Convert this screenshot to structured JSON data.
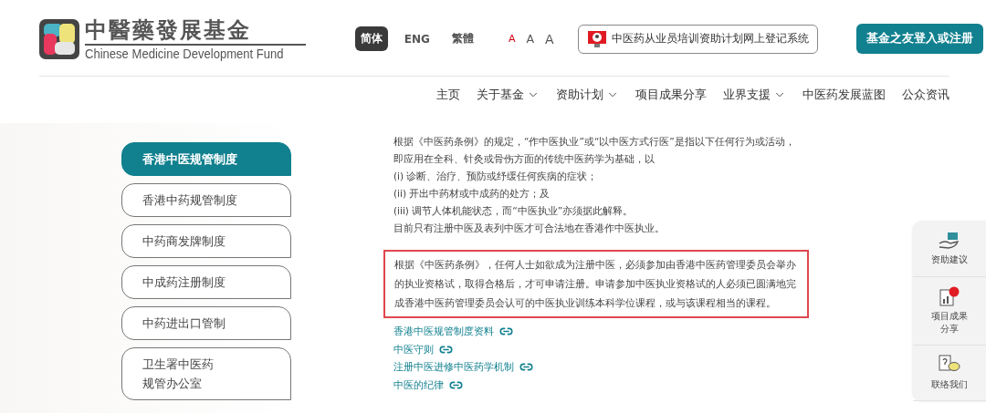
{
  "logo": {
    "title": "中醫藥發展基金",
    "subtitle": "Chinese Medicine Development Fund"
  },
  "languages": [
    {
      "label": "简体",
      "selected": true
    },
    {
      "label": "ENG",
      "selected": false
    },
    {
      "label": "繁體",
      "selected": false
    }
  ],
  "font_sizes": [
    {
      "label": "A",
      "selected": true
    },
    {
      "label": "A",
      "selected": false
    },
    {
      "label": "A",
      "selected": false
    }
  ],
  "system_button": "中医药从业员培训资助计划网上登记系统",
  "login_button": "基金之友登入或注册",
  "nav": [
    {
      "label": "主页",
      "has_menu": false
    },
    {
      "label": "关于基金",
      "has_menu": true
    },
    {
      "label": "资助计划",
      "has_menu": true
    },
    {
      "label": "项目成果分享",
      "has_menu": false
    },
    {
      "label": "业界支援",
      "has_menu": true
    },
    {
      "label": "中医药发展蓝图",
      "has_menu": false
    },
    {
      "label": "公众资讯",
      "has_menu": false
    }
  ],
  "sidebar": {
    "items": [
      {
        "label": "香港中医规管制度",
        "selected": true
      },
      {
        "label": "香港中药规管制度",
        "selected": false
      },
      {
        "label": "中药商发牌制度",
        "selected": false
      },
      {
        "label": "中成药注册制度",
        "selected": false
      },
      {
        "label": "中药进出口管制",
        "selected": false
      },
      {
        "lines": [
          "卫生署中医药",
          "规管办公室"
        ],
        "selected": false
      }
    ]
  },
  "content": {
    "lines": [
      "根据《中医药条例》的规定，“作中医执业”或“以中医方式行医”是指以下任何行为或活动，即应用在全科、针灸或骨伤方面的传统中医药学为基础，以",
      "(i) 诊断、治疗、预防或纾缓任何疾病的症状；",
      "(ii) 开出中药材或中成药的处方；及",
      "(iii) 调节人体机能状态，而“中医执业”亦须据此解释。",
      "目前只有注册中医及表列中医才可合法地在香港作中医执业。"
    ],
    "highlighted": "根据《中医药条例》，任何人士如欲成为注册中医，必须参加由香港中医药管理委员会举办的执业资格试，取得合格后，才可申请注册。申请参加中医执业资格试的人必须已圆满地完成香港中医药管理委员会认可的中医执业训练本科学位课程，或与该课程相当的课程。",
    "links": [
      "香港中医规管制度资料",
      "中医守则",
      "注册中医进修中医药学机制",
      "中医的纪律"
    ]
  },
  "side_panel": [
    {
      "kind": "suggest",
      "label": "资助建议"
    },
    {
      "kind": "results",
      "lines": [
        "项目成果",
        "分享"
      ]
    },
    {
      "kind": "contact",
      "label": "联络我们"
    }
  ]
}
